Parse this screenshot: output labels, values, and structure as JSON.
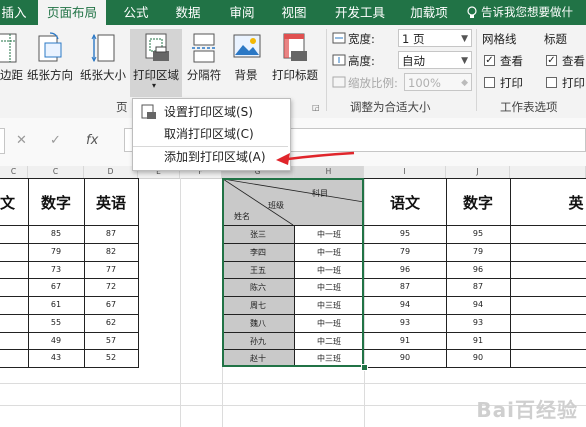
{
  "tabs": [
    "插入",
    "页面布局",
    "公式",
    "数据",
    "审阅",
    "视图",
    "开发工具",
    "加载项"
  ],
  "tell_me": "告诉我您想要做什",
  "ribbon": {
    "margins": "边距",
    "orientation": "纸张方向",
    "size": "纸张大小",
    "print_area": "打印区域",
    "breaks": "分隔符",
    "background": "背景",
    "print_titles": "打印标题",
    "group_page_setup_partial": "页",
    "width_label": "宽度:",
    "width_value": "1 页",
    "height_label": "高度:",
    "height_value": "自动",
    "scale_label": "缩放比例:",
    "scale_value": "100%",
    "group_scale": "调整为合适大小",
    "gridlines": "网格线",
    "headings": "标题",
    "view": "查看",
    "print": "打印",
    "group_sheet_options": "工作表选项"
  },
  "formula_bar": {
    "fx": "fx"
  },
  "print_area_menu": [
    "设置打印区域(S)",
    "取消打印区域(C)",
    "添加到打印区域(A)"
  ],
  "columns": [
    "C",
    "D",
    "E",
    "F",
    "G",
    "H",
    "I",
    "J"
  ],
  "left_table": {
    "partial_header": "文",
    "h_math": "数字",
    "h_english": "英语",
    "math": [
      85,
      79,
      73,
      67,
      61,
      55,
      49,
      43
    ],
    "english": [
      87,
      82,
      77,
      72,
      67,
      62,
      57,
      52
    ]
  },
  "mid_table": {
    "diag_subject": "科目",
    "diag_class": "班级",
    "diag_name": "姓名",
    "names": [
      "张三",
      "李四",
      "王五",
      "陈六",
      "周七",
      "魏八",
      "孙九",
      "赵十"
    ],
    "classes": [
      "中一班",
      "中一班",
      "中一班",
      "中二班",
      "中三班",
      "中一班",
      "中二班",
      "中三班"
    ]
  },
  "right_table": {
    "h_chinese": "语文",
    "h_math": "数字",
    "partial_header": "英",
    "chinese": [
      95,
      79,
      96,
      87,
      94,
      93,
      91,
      90
    ],
    "math": [
      95,
      79,
      96,
      87,
      94,
      93,
      91,
      90
    ]
  },
  "watermark": "Bai百经验"
}
